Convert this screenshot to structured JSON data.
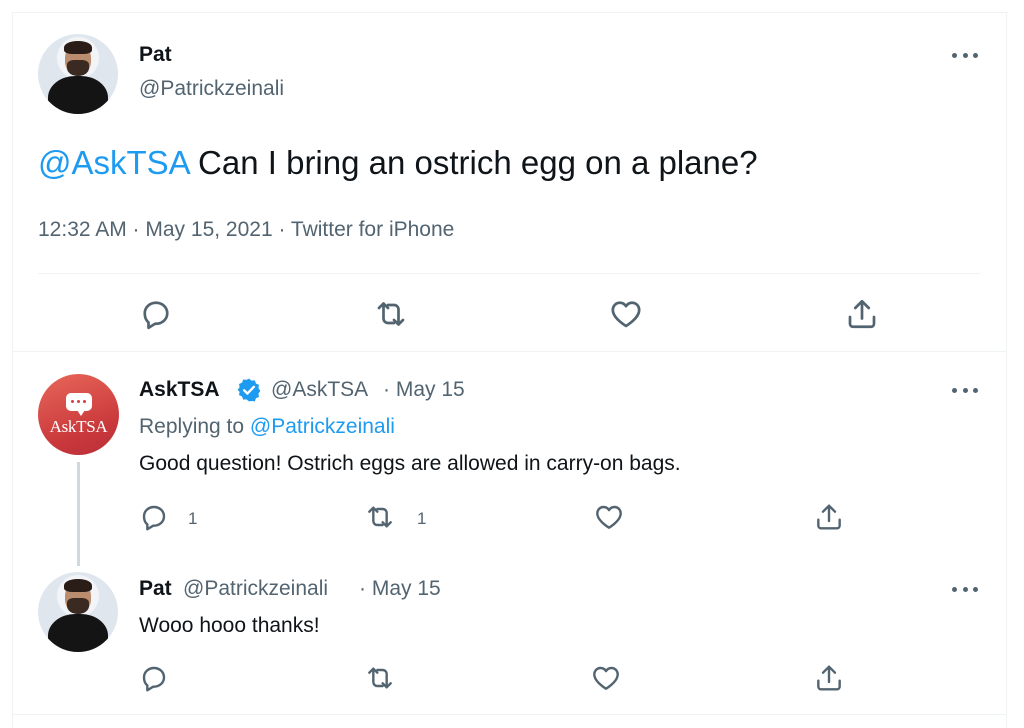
{
  "colors": {
    "link": "#1d9bf0",
    "secondary_text": "#536471",
    "primary_text": "#0f1419",
    "verified": "#1d9bf0"
  },
  "main_tweet": {
    "author_name": "Pat",
    "author_handle": "@Patrickzeinali",
    "mention": "@AskTSA",
    "text": " Can I bring an ostrich egg on a plane?",
    "timestamp": "12:32 AM · May 15, 2021 · Twitter for iPhone",
    "icons": [
      "reply-icon",
      "retweet-icon",
      "like-icon",
      "share-icon"
    ]
  },
  "reply_1": {
    "author_name": "AskTSA",
    "author_handle": "@AskTSA",
    "date": "· May 15",
    "replying_prefix": "Replying to ",
    "replying_to": "@Patrickzeinali",
    "text": "Good question! Ostrich eggs are allowed in carry-on bags.",
    "reply_count": "1",
    "retweet_count": "1",
    "avatar_text": "AskTSA"
  },
  "reply_2": {
    "author_name": "Pat",
    "author_handle": "@Patrickzeinali",
    "date": "· May 15",
    "text": "Wooo hooo thanks!"
  }
}
